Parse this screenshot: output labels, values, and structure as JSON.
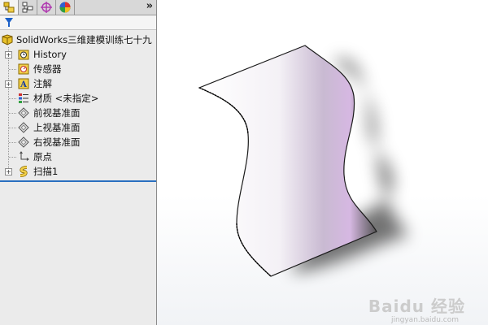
{
  "tabs": [
    {
      "name": "feature-manager",
      "active": true
    },
    {
      "name": "property-manager",
      "active": false
    },
    {
      "name": "configuration-manager",
      "active": false
    },
    {
      "name": "appearance-manager",
      "active": false
    }
  ],
  "more_glyph": "»",
  "tree": {
    "root_label": "SolidWorks三维建模训练七十九",
    "items": [
      {
        "label": "History",
        "icon": "history-icon",
        "expandable": true
      },
      {
        "label": "传感器",
        "icon": "sensor-icon",
        "expandable": false
      },
      {
        "label": "注解",
        "icon": "annotation-icon",
        "expandable": true
      },
      {
        "label": "材质 <未指定>",
        "icon": "material-icon",
        "expandable": false
      },
      {
        "label": "前视基准面",
        "icon": "plane-icon",
        "expandable": false
      },
      {
        "label": "上视基准面",
        "icon": "plane-icon",
        "expandable": false
      },
      {
        "label": "右视基准面",
        "icon": "plane-icon",
        "expandable": false
      },
      {
        "label": "原点",
        "icon": "origin-icon",
        "expandable": false
      },
      {
        "label": "扫描1",
        "icon": "sweep-icon",
        "expandable": true
      }
    ]
  },
  "watermark": {
    "text": "Baidu 经验",
    "sub": "jingyan.baidu.com"
  },
  "colors": {
    "accent": "#2a6fc0",
    "panel_bg": "#ebebeb",
    "folder": "#e8c12a"
  }
}
